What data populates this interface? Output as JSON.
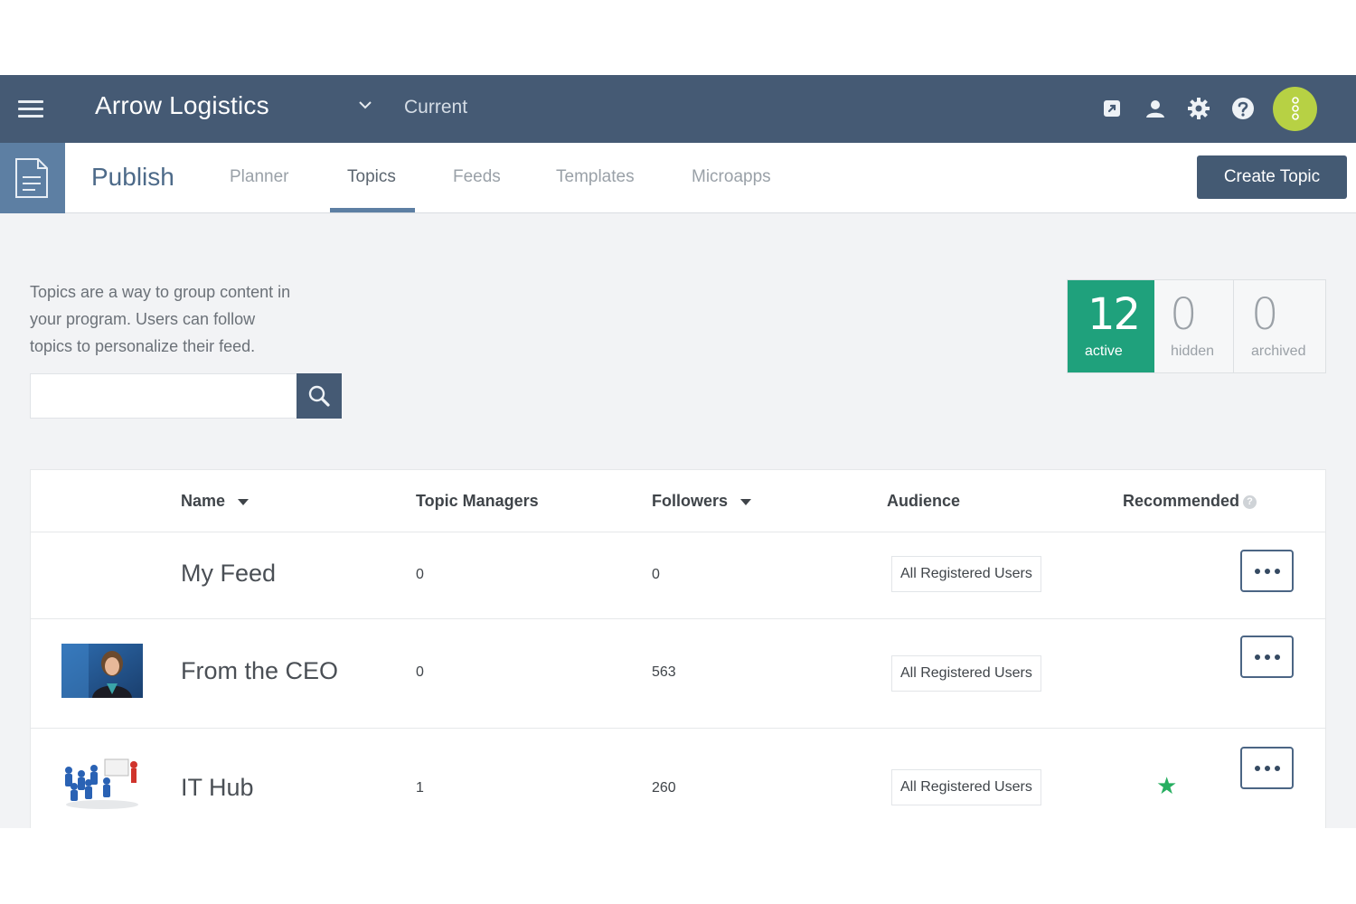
{
  "header": {
    "org_name": "Arrow Logistics",
    "context_label": "Current",
    "icons": [
      "external-link-icon",
      "user-icon",
      "gear-icon",
      "help-icon",
      "more-vertical-icon"
    ]
  },
  "subnav": {
    "section_title": "Publish",
    "tabs": [
      {
        "label": "Planner",
        "active": false
      },
      {
        "label": "Topics",
        "active": true
      },
      {
        "label": "Feeds",
        "active": false
      },
      {
        "label": "Templates",
        "active": false
      },
      {
        "label": "Microapps",
        "active": false
      }
    ],
    "create_button": "Create Topic"
  },
  "intro": {
    "text": "Topics are a way to group content in your program. Users can follow topics to personalize their feed."
  },
  "search": {
    "value": "",
    "placeholder": ""
  },
  "stats": [
    {
      "value": "12",
      "label": "active"
    },
    {
      "value": "0",
      "label": "hidden"
    },
    {
      "value": "0",
      "label": "archived"
    }
  ],
  "table": {
    "columns": {
      "name": "Name",
      "managers": "Topic Managers",
      "followers": "Followers",
      "audience": "Audience",
      "recommended": "Recommended"
    },
    "rows": [
      {
        "name": "My Feed",
        "managers": "0",
        "followers": "0",
        "audience": "All Registered Users",
        "recommended": false
      },
      {
        "name": "From the CEO",
        "managers": "0",
        "followers": "563",
        "audience": "All Registered Users",
        "recommended": false
      },
      {
        "name": "IT Hub",
        "managers": "1",
        "followers": "260",
        "audience": "All Registered Users",
        "recommended": true
      }
    ]
  },
  "colors": {
    "header_bg": "#455a74",
    "accent_blue": "#5d7fa3",
    "active_green": "#1fa17c",
    "avatar_green": "#b7d144",
    "star_green": "#27ae60"
  }
}
